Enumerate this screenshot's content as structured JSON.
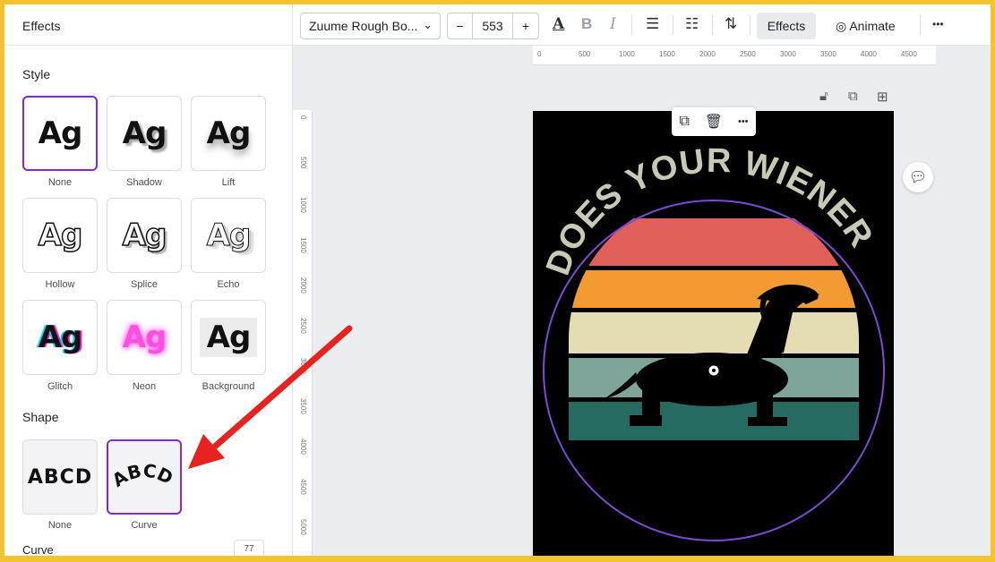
{
  "panel": {
    "title": "Effects",
    "style_section": "Style",
    "style_tiles": [
      {
        "preview": "Ag",
        "label": "None"
      },
      {
        "preview": "Ag",
        "label": "Shadow"
      },
      {
        "preview": "Ag",
        "label": "Lift"
      },
      {
        "preview": "Ag",
        "label": "Hollow"
      },
      {
        "preview": "Ag",
        "label": "Splice"
      },
      {
        "preview": "Ag",
        "label": "Echo"
      },
      {
        "preview": "Ag",
        "label": "Glitch"
      },
      {
        "preview": "Ag",
        "label": "Neon"
      },
      {
        "preview": "Ag",
        "label": "Background"
      }
    ],
    "shape_section": "Shape",
    "shape_tiles": [
      {
        "preview": "ABCD",
        "label": "None"
      },
      {
        "preview": "ABCD",
        "label": "Curve"
      }
    ],
    "curve_label": "Curve",
    "curve_value": "77",
    "selected_accent": "#7d2ae8"
  },
  "toolbar": {
    "font_name": "Zuume Rough Bo...",
    "font_size": "553",
    "minus": "−",
    "plus": "+",
    "effects_label": "Effects",
    "animate_label": "Animate",
    "more": "•••"
  },
  "ruler_top": [
    "0",
    "500",
    "1000",
    "1500",
    "2000",
    "2500",
    "3000",
    "3500",
    "4000",
    "4500"
  ],
  "ruler_left": [
    "0",
    "500",
    "1000",
    "1500",
    "2000",
    "2500",
    "3000",
    "3500",
    "4000",
    "4500",
    "5000"
  ],
  "canvas": {
    "headline": "DOES YOUR WIENER",
    "headline_color": "#c9c9b4",
    "stripe_colors": [
      "#e0615a",
      "#f39a33",
      "#e4dcb3",
      "#7fa59a",
      "#256b62"
    ],
    "circle_color": "#7d49d6",
    "float_bar_icons": [
      "copy-icon",
      "trash-icon",
      "more-icon"
    ]
  },
  "annotation": {
    "arrow_color": "#e8231f"
  }
}
